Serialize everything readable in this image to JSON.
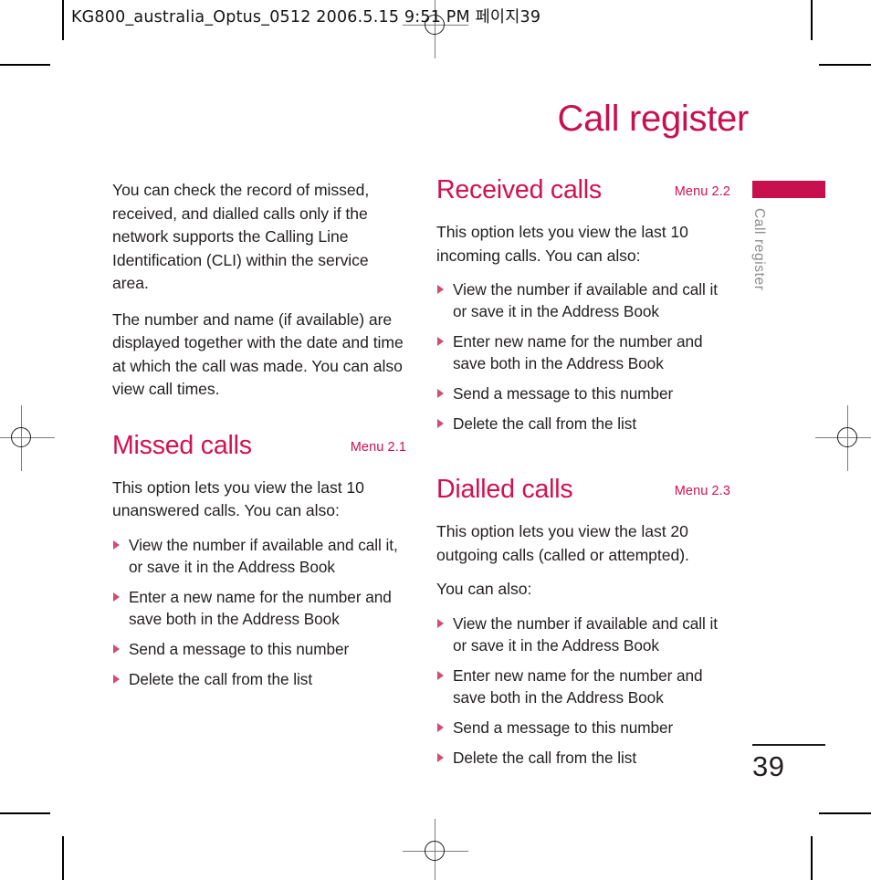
{
  "slug": {
    "text": "KG800_australia_Optus_0512  2006.5.15 9:51 PM  페이지39"
  },
  "chapter": {
    "title": "Call register",
    "tab_label": "Call register",
    "accent_color": "#c8104e"
  },
  "folio": {
    "page_number": "39"
  },
  "left_column": {
    "intro_paragraphs": [
      "You can check the record of missed, received, and dialled calls only if the network supports the Calling Line Identification (CLI) within the service area.",
      "The number and name (if available) are displayed together with the date and time at which the call was made. You can also view call times."
    ],
    "section": {
      "title": "Missed calls",
      "menu_ref": "Menu 2.1",
      "intro": "This option lets you view the last 10 unanswered calls. You can also:",
      "bullets": [
        "View the number if available and call it, or save it in the Address Book",
        "Enter a new name for the number and save both in the Address Book",
        "Send a message to this number",
        "Delete the call from the list"
      ]
    }
  },
  "right_column": {
    "sections": [
      {
        "title": "Received calls",
        "menu_ref": "Menu 2.2",
        "intro": "This option lets you view the last 10 incoming calls. You can also:",
        "intro_extra": "",
        "bullets": [
          "View the number if available and call it or save it in the Address Book",
          "Enter new name for the number and save both in the Address Book",
          "Send a message to this number",
          "Delete the call from the list"
        ]
      },
      {
        "title": "Dialled calls",
        "menu_ref": "Menu 2.3",
        "intro": "This option lets you view the last 20 outgoing calls (called or attempted).",
        "intro_extra": "You can also:",
        "bullets": [
          "View the number if available and call it or save it in the Address Book",
          "Enter new name for the number and save both in the Address Book",
          "Send a message to this number",
          "Delete the call from the list"
        ]
      }
    ]
  }
}
